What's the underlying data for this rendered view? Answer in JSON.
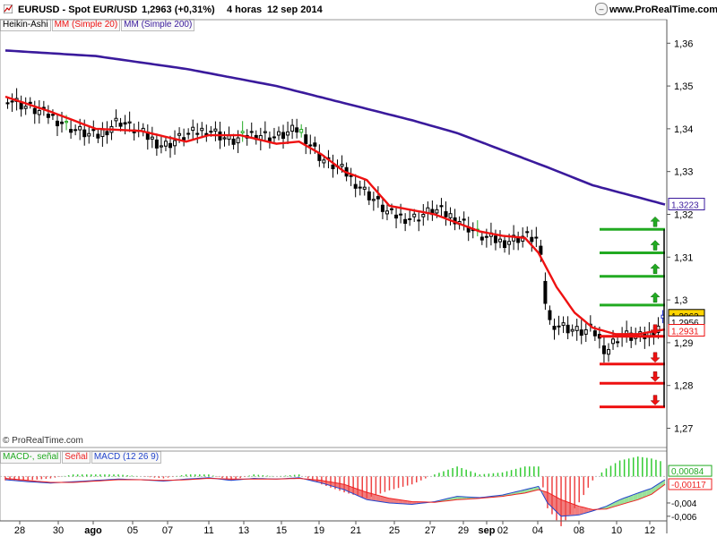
{
  "header": {
    "symbol": "EURUSD - Spot EUR/USD",
    "price": "1,2963 (+0,31%)",
    "timeframe": "4 horas",
    "date": "12 sep 2014",
    "site": "www.ProRealTime.com"
  },
  "legend": {
    "ha": "Heikin-Ashi",
    "ma20": "MM (Simple 20)",
    "ma200": "MM (Simple 200)"
  },
  "macd_legend": {
    "l1": "MACD-, señal",
    "l2": "Señal",
    "l3": "MACD (12 26 9)"
  },
  "watermark": "© ProRealTime.com",
  "colors": {
    "ma20": "#ee1111",
    "ma200": "#3a1a9c",
    "up": "#22aa22",
    "down": "#ee1111",
    "candle": "#000000",
    "hist_pos": "#33cc33",
    "hist_neg": "#ee4444",
    "fill_pos": "#88dd88",
    "fill_neg": "#ee6666",
    "signal_line": "#ee2222",
    "macd_line": "#2244cc"
  },
  "chart_data": {
    "type": "line",
    "title": "EURUSD - Spot EUR/USD",
    "x_ticks": [
      "28",
      "30",
      "ago",
      "05",
      "07",
      "11",
      "13",
      "15",
      "19",
      "21",
      "25",
      "27",
      "29",
      "sep",
      "02",
      "04",
      "08",
      "10",
      "12"
    ],
    "y_ticks": [
      "1,36",
      "1,35",
      "1,34",
      "1,33",
      "1,32",
      "1,31",
      "1,3",
      "1,29",
      "1,28",
      "1,27"
    ],
    "y_tick_values": [
      1.36,
      1.35,
      1.34,
      1.33,
      1.32,
      1.31,
      1.3,
      1.29,
      1.28,
      1.27
    ],
    "ylim": [
      1.2655,
      1.3655
    ],
    "n_bars": 146,
    "series": [
      {
        "name": "MM (Simple 200)",
        "key": "ma200",
        "points": [
          [
            0,
            1.3583
          ],
          [
            20,
            1.357
          ],
          [
            40,
            1.354
          ],
          [
            60,
            1.35
          ],
          [
            75,
            1.346
          ],
          [
            90,
            1.342
          ],
          [
            100,
            1.339
          ],
          [
            110,
            1.335
          ],
          [
            120,
            1.331
          ],
          [
            130,
            1.3268
          ],
          [
            146,
            1.3223
          ]
        ]
      },
      {
        "name": "MM (Simple 20)",
        "key": "ma20",
        "points": [
          [
            0,
            1.3475
          ],
          [
            10,
            1.344
          ],
          [
            20,
            1.34
          ],
          [
            30,
            1.3395
          ],
          [
            40,
            1.337
          ],
          [
            45,
            1.3385
          ],
          [
            52,
            1.3385
          ],
          [
            60,
            1.3365
          ],
          [
            65,
            1.337
          ],
          [
            70,
            1.334
          ],
          [
            75,
            1.33
          ],
          [
            80,
            1.328
          ],
          [
            85,
            1.322
          ],
          [
            90,
            1.321
          ],
          [
            95,
            1.32
          ],
          [
            100,
            1.318
          ],
          [
            105,
            1.316
          ],
          [
            110,
            1.315
          ],
          [
            115,
            1.3145
          ],
          [
            118,
            1.311
          ],
          [
            122,
            1.303
          ],
          [
            126,
            1.297
          ],
          [
            130,
            1.2935
          ],
          [
            135,
            1.292
          ],
          [
            140,
            1.292
          ],
          [
            146,
            1.2931
          ]
        ]
      }
    ],
    "price_path": [
      [
        0,
        1.3475
      ],
      [
        5,
        1.345
      ],
      [
        10,
        1.343
      ],
      [
        15,
        1.34
      ],
      [
        20,
        1.338
      ],
      [
        25,
        1.342
      ],
      [
        30,
        1.339
      ],
      [
        35,
        1.336
      ],
      [
        40,
        1.3385
      ],
      [
        45,
        1.34
      ],
      [
        50,
        1.337
      ],
      [
        55,
        1.339
      ],
      [
        60,
        1.338
      ],
      [
        65,
        1.34
      ],
      [
        70,
        1.333
      ],
      [
        75,
        1.33
      ],
      [
        80,
        1.325
      ],
      [
        85,
        1.32
      ],
      [
        90,
        1.319
      ],
      [
        95,
        1.321
      ],
      [
        100,
        1.319
      ],
      [
        105,
        1.315
      ],
      [
        110,
        1.3135
      ],
      [
        115,
        1.315
      ],
      [
        118,
        1.314
      ],
      [
        120,
        1.295
      ],
      [
        123,
        1.294
      ],
      [
        127,
        1.2925
      ],
      [
        130,
        1.293
      ],
      [
        133,
        1.288
      ],
      [
        136,
        1.292
      ],
      [
        140,
        1.291
      ],
      [
        143,
        1.292
      ],
      [
        146,
        1.2963
      ]
    ],
    "price_labels": [
      {
        "text": "1,3223",
        "value": 1.3223,
        "color": "#3a1a9c",
        "bg": "#ffffff"
      },
      {
        "text": "1,2963",
        "value": 1.2963,
        "color": "#000000",
        "bg": "#ffd400"
      },
      {
        "text": "1,2956",
        "value": 1.2948,
        "color": "#000000",
        "bg": "#ffffff"
      },
      {
        "text": "1,2931",
        "value": 1.2928,
        "color": "#ee1111",
        "bg": "#ffffff"
      }
    ],
    "levels": [
      {
        "value": 1.3165,
        "color": "green",
        "arrow": "up"
      },
      {
        "value": 1.311,
        "color": "green",
        "arrow": "up"
      },
      {
        "value": 1.3055,
        "color": "green",
        "arrow": "up"
      },
      {
        "value": 1.2988,
        "color": "green",
        "arrow": "up"
      },
      {
        "value": 1.2915,
        "color": "red",
        "arrow": "down"
      },
      {
        "value": 1.285,
        "color": "red",
        "arrow": "down"
      },
      {
        "value": 1.2805,
        "color": "red",
        "arrow": "down"
      },
      {
        "value": 1.275,
        "color": "red",
        "arrow": "down"
      }
    ],
    "macd": {
      "y_ticks": [
        "0,00084",
        "-0,00117",
        "-0,004",
        "-0,006"
      ],
      "y_tick_values": [
        0.00084,
        -0.00117,
        -0.004,
        -0.006
      ],
      "ylim": [
        -0.0067,
        0.0022
      ],
      "macd_points": [
        [
          0,
          -0.0005
        ],
        [
          5,
          -0.0008
        ],
        [
          10,
          -0.001
        ],
        [
          15,
          -0.0008
        ],
        [
          20,
          -0.0006
        ],
        [
          25,
          -0.0004
        ],
        [
          30,
          -0.0005
        ],
        [
          35,
          -0.0007
        ],
        [
          40,
          -0.0004
        ],
        [
          45,
          -0.0002
        ],
        [
          50,
          -0.0006
        ],
        [
          55,
          -0.0003
        ],
        [
          60,
          -0.0004
        ],
        [
          65,
          -0.0002
        ],
        [
          70,
          -0.001
        ],
        [
          75,
          -0.002
        ],
        [
          80,
          -0.0035
        ],
        [
          85,
          -0.004
        ],
        [
          90,
          -0.0042
        ],
        [
          95,
          -0.0038
        ],
        [
          100,
          -0.003
        ],
        [
          105,
          -0.0032
        ],
        [
          110,
          -0.0028
        ],
        [
          115,
          -0.002
        ],
        [
          118,
          -0.0015
        ],
        [
          120,
          -0.004
        ],
        [
          123,
          -0.006
        ],
        [
          127,
          -0.0058
        ],
        [
          130,
          -0.0052
        ],
        [
          133,
          -0.0045
        ],
        [
          136,
          -0.0035
        ],
        [
          140,
          -0.0025
        ],
        [
          143,
          -0.0018
        ],
        [
          146,
          -0.0005
        ]
      ],
      "signal_points": [
        [
          0,
          -0.0003
        ],
        [
          5,
          -0.0006
        ],
        [
          10,
          -0.0009
        ],
        [
          15,
          -0.0009
        ],
        [
          20,
          -0.0007
        ],
        [
          25,
          -0.0005
        ],
        [
          30,
          -0.0005
        ],
        [
          35,
          -0.0006
        ],
        [
          40,
          -0.0005
        ],
        [
          45,
          -0.0003
        ],
        [
          50,
          -0.0004
        ],
        [
          55,
          -0.0004
        ],
        [
          60,
          -0.0004
        ],
        [
          65,
          -0.0003
        ],
        [
          70,
          -0.0006
        ],
        [
          75,
          -0.0012
        ],
        [
          80,
          -0.0024
        ],
        [
          85,
          -0.0033
        ],
        [
          90,
          -0.0038
        ],
        [
          95,
          -0.0039
        ],
        [
          100,
          -0.0035
        ],
        [
          105,
          -0.0033
        ],
        [
          110,
          -0.003
        ],
        [
          115,
          -0.0025
        ],
        [
          118,
          -0.002
        ],
        [
          120,
          -0.0024
        ],
        [
          123,
          -0.0035
        ],
        [
          127,
          -0.0045
        ],
        [
          130,
          -0.005
        ],
        [
          133,
          -0.0049
        ],
        [
          136,
          -0.0043
        ],
        [
          140,
          -0.0035
        ],
        [
          143,
          -0.0027
        ],
        [
          146,
          -0.0012
        ]
      ]
    }
  }
}
